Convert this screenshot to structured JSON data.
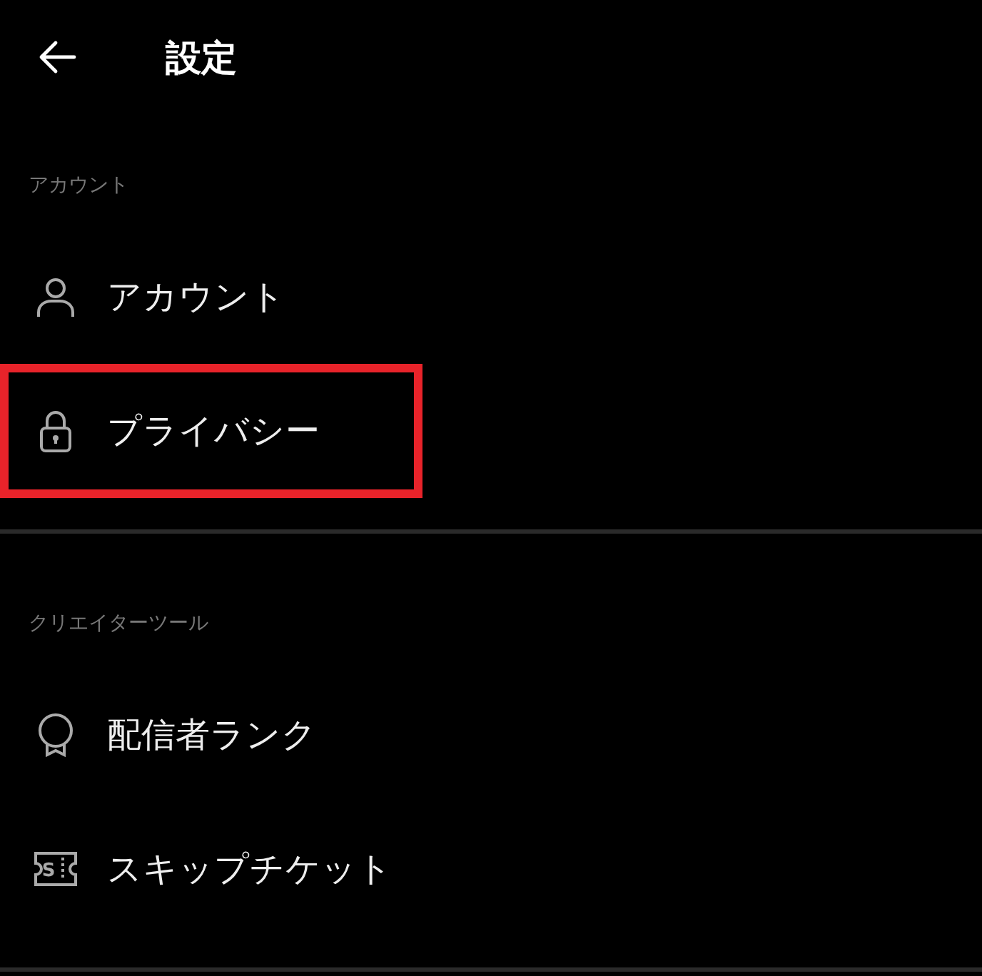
{
  "header": {
    "title": "設定"
  },
  "sections": [
    {
      "label": "アカウント",
      "items": [
        {
          "kind": "person",
          "label": "アカウント",
          "highlighted": false
        },
        {
          "kind": "lock",
          "label": "プライバシー",
          "highlighted": true
        }
      ]
    },
    {
      "label": "クリエイターツール",
      "items": [
        {
          "kind": "medal",
          "label": "配信者ランク",
          "highlighted": false
        },
        {
          "kind": "ticket",
          "label": "スキップチケット",
          "badge": "S",
          "highlighted": false
        }
      ]
    }
  ]
}
